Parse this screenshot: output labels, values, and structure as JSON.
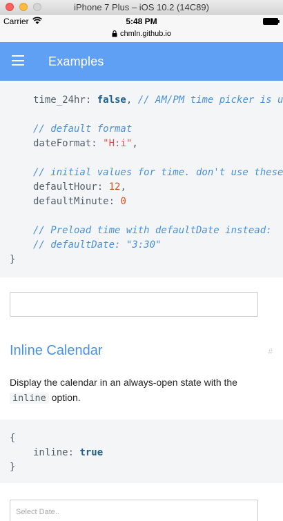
{
  "window": {
    "title": "iPhone 7 Plus – iOS 10.2 (14C89)"
  },
  "status_bar": {
    "carrier": "Carrier",
    "time": "5:48 PM",
    "icons": [
      "wifi-icon",
      "battery-icon"
    ]
  },
  "url_bar": {
    "url": "chmln.github.io",
    "icon": "lock-icon"
  },
  "app_bar": {
    "title": "Examples",
    "menu_icon": "menu-icon",
    "color": "#5fa0f4"
  },
  "code_block_1": {
    "lines": [
      {
        "prop": "time_24hr",
        "sep": ": ",
        "value": "false",
        "trail": ",",
        "comment": "// AM/PM time picker is used by default"
      },
      {
        "blank": true
      },
      {
        "comment_only": "// default format"
      },
      {
        "prop": "dateFormat",
        "sep": ": ",
        "value": "\"H:i\"",
        "trail": ","
      },
      {
        "blank": true
      },
      {
        "comment_only": "// initial values for time. don't use these to preload a date"
      },
      {
        "prop": "defaultHour",
        "sep": ": ",
        "value": "12",
        "trail": ","
      },
      {
        "prop": "defaultMinute",
        "sep": ": ",
        "value": "0"
      },
      {
        "blank": true
      },
      {
        "comment_only": "// Preload time with defaultDate instead:"
      },
      {
        "comment_only": "// defaultDate: \"3:30\""
      },
      {
        "closing": "}"
      }
    ]
  },
  "time_input": {
    "value": "",
    "placeholder": ""
  },
  "section": {
    "title": "Inline Calendar",
    "anchor": "#",
    "description_before": "Display the calendar in an always-open state with the ",
    "description_code": "inline",
    "description_after": " option."
  },
  "code_block_2": {
    "open": "{",
    "prop": "inline",
    "sep": ": ",
    "value": "true",
    "close": "}"
  },
  "date_input": {
    "placeholder": "Select Date.."
  },
  "colors": {
    "accent": "#4a90e2",
    "code_bg": "#f4f5f6",
    "keyword": "#1f5f8b",
    "number": "#d9531e",
    "comment": "#4a90d9"
  }
}
